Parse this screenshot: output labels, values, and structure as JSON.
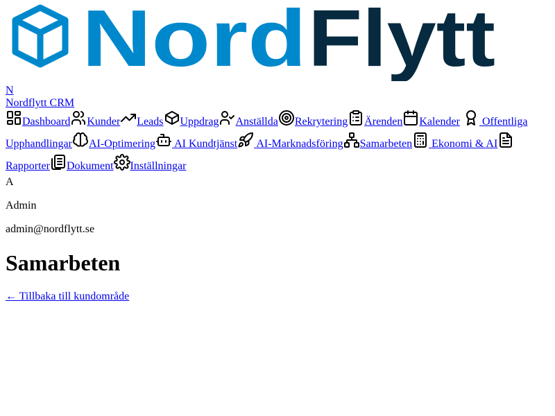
{
  "brand": {
    "logo_text": "NordFlytt",
    "logo_primary_color": "#0088cc",
    "logo_secondary_color": "#062a3f",
    "initial_link": "N",
    "name_link": "Nordflytt CRM"
  },
  "nav": [
    {
      "label": "Dashboard",
      "icon": "layout-dashboard-icon"
    },
    {
      "label": "Kunder",
      "icon": "users-icon"
    },
    {
      "label": "Leads",
      "icon": "trending-up-icon"
    },
    {
      "label": "Uppdrag",
      "icon": "package-icon"
    },
    {
      "label": "Anställda",
      "icon": "user-check-icon"
    },
    {
      "label": "Rekrytering",
      "icon": "target-icon"
    },
    {
      "label": "Ärenden",
      "icon": "clipboard-list-icon"
    },
    {
      "label": "Kalender",
      "icon": "calendar-icon"
    },
    {
      "label": "Offentliga Upphandlingar",
      "icon": "award-icon"
    },
    {
      "label": "AI-Optimering",
      "icon": "brain-icon"
    },
    {
      "label": "AI Kundtjänst",
      "icon": "bot-icon"
    },
    {
      "label": "AI-Marknadsföring",
      "icon": "rocket-icon"
    },
    {
      "label": "Samarbeten",
      "icon": "network-icon"
    },
    {
      "label": "Ekonomi & AI",
      "icon": "calculator-icon"
    },
    {
      "label": "Rapporter",
      "icon": "file-text-icon"
    },
    {
      "label": "Dokument",
      "icon": "files-icon"
    },
    {
      "label": "Inställningar",
      "icon": "settings-icon"
    }
  ],
  "user": {
    "avatar_initial": "A",
    "name": "Admin",
    "email": "admin@nordflytt.se"
  },
  "main": {
    "title": "Samarbeten",
    "back_link": "← Tillbaka till kundområde"
  }
}
